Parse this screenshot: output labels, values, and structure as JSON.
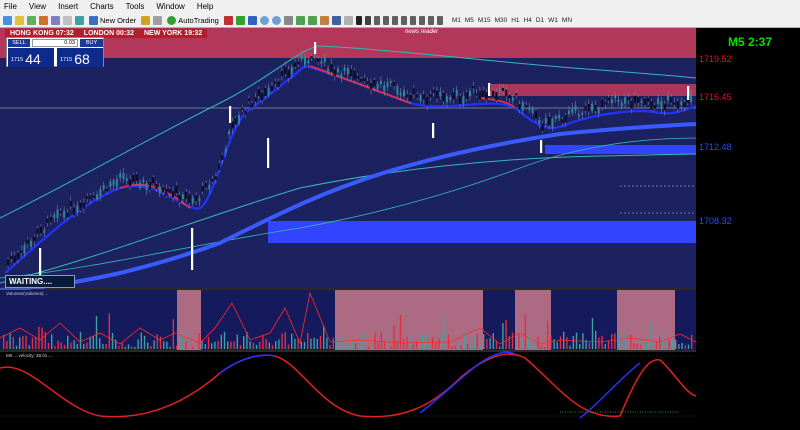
{
  "menu": [
    "File",
    "View",
    "Insert",
    "Charts",
    "Tools",
    "Window",
    "Help"
  ],
  "toolbar": {
    "new_order": "New Order",
    "autotrading": "AutoTrading",
    "timeframes": [
      "M1",
      "M5",
      "M15",
      "M30",
      "H1",
      "H4",
      "D1",
      "W1",
      "MN"
    ]
  },
  "sessions": {
    "hong_kong": "HONG KONG 07:32",
    "london": "LONDON 00:32",
    "new_york": "NEW YORK 19:32"
  },
  "news_reader": "news reader",
  "one_click": {
    "sell": "SELL",
    "buy": "BUY",
    "lot": "0.03",
    "sell_big": "1715",
    "sell_small": "44",
    "buy_big": "1715",
    "buy_small": "68"
  },
  "timer": "M5 2:37",
  "levels": {
    "r1": "1719.52",
    "r2": "1716.45",
    "s1": "1712.48",
    "s2": "1708.32"
  },
  "status": "WAITING....",
  "indicator1_label": "Volumes(Volumes) ...",
  "indicator2_label": "M5 ... velocity: 38.01 ...",
  "colors": {
    "bg": "#1c2260",
    "zone_red": "#c43a5a",
    "zone_blue": "#3344ff",
    "ema_fast": "#2233ff",
    "ema_slow": "#3a5cff",
    "band": "#35b8b8",
    "candle": "#ffffff"
  }
}
